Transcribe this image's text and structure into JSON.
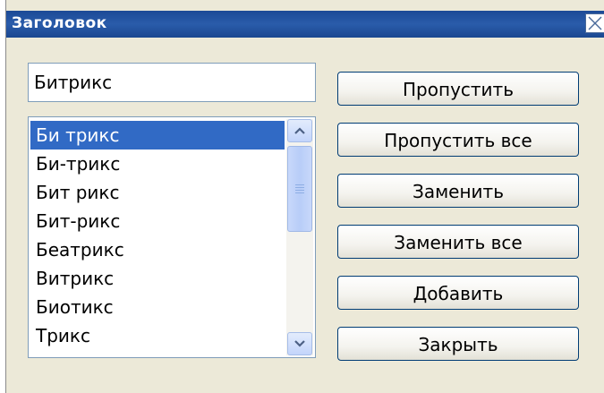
{
  "window": {
    "title": "Заголовок",
    "close_icon": "close-icon"
  },
  "word_input": {
    "value": "Битрикс"
  },
  "suggestions": {
    "items": [
      "Би трикс",
      "Би-трикс",
      "Бит рикс",
      "Бит-рикс",
      "Беатрикс",
      "Витрикс",
      "Биотикс",
      "Трикс"
    ],
    "selected_index": 0
  },
  "buttons": {
    "skip": "Пропустить",
    "skip_all": "Пропустить все",
    "replace": "Заменить",
    "replace_all": "Заменить все",
    "add": "Добавить",
    "close": "Закрыть"
  },
  "colors": {
    "titlebar": "#2a5caa",
    "selection": "#316ac5",
    "dialog_bg": "#ece9d8",
    "button_border": "#003c74"
  }
}
